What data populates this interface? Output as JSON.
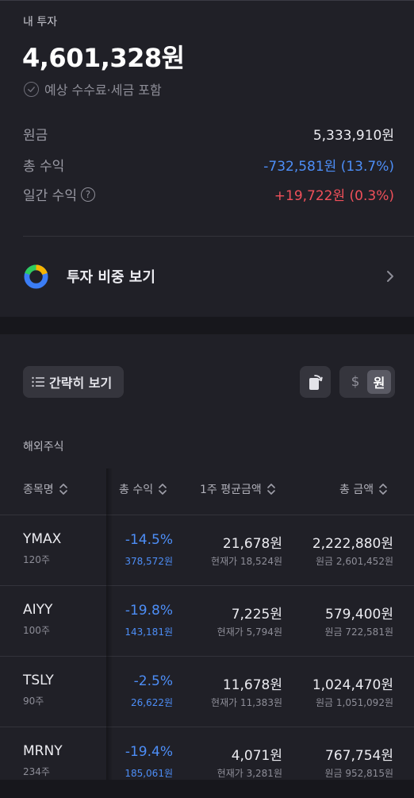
{
  "summary": {
    "section_title": "내 투자",
    "total_value": "4,601,328원",
    "fee_note": "예상 수수료·세금 포함",
    "principal_label": "원금",
    "principal_value": "5,333,910원",
    "total_return_label": "총 수익",
    "total_return_value": "-732,581원 (13.7%)",
    "daily_return_label": "일간 수익",
    "daily_return_value": "+19,722원 (0.3%)",
    "help_icon_text": "?"
  },
  "weight": {
    "label": "투자 비중 보기",
    "donut_colors": [
      "#f5b400",
      "#2ecc5e",
      "#3b7df5"
    ]
  },
  "toolbar": {
    "simple_view_label": "간략히 보기",
    "currency_usd": "$",
    "currency_krw": "원"
  },
  "market_label": "해외주식",
  "table": {
    "headers": [
      "종목명",
      "총 수익",
      "1주 평균금액",
      "총 금액"
    ],
    "rows": [
      {
        "name": "YMAX",
        "qty": "120주",
        "rate": "-14.5%",
        "profit": "378,572원",
        "avg": "21,678원",
        "current": "현재가 18,524원",
        "total": "2,222,880원",
        "principal": "원금 2,601,452원"
      },
      {
        "name": "AIYY",
        "qty": "100주",
        "rate": "-19.8%",
        "profit": "143,181원",
        "avg": "7,225원",
        "current": "현재가 5,794원",
        "total": "579,400원",
        "principal": "원금 722,581원"
      },
      {
        "name": "TSLY",
        "qty": "90주",
        "rate": "-2.5%",
        "profit": "26,622원",
        "avg": "11,678원",
        "current": "현재가 11,383원",
        "total": "1,024,470원",
        "principal": "원금 1,051,092원"
      },
      {
        "name": "MRNY",
        "qty": "234주",
        "rate": "-19.4%",
        "profit": "185,061원",
        "avg": "4,071원",
        "current": "현재가 3,281원",
        "total": "767,754원",
        "principal": "원금 952,815원"
      }
    ]
  },
  "colors": {
    "accent_blue": "#4d8ef7",
    "accent_red": "#f0505a",
    "card_bg": "#202027",
    "page_bg": "#17171c"
  }
}
